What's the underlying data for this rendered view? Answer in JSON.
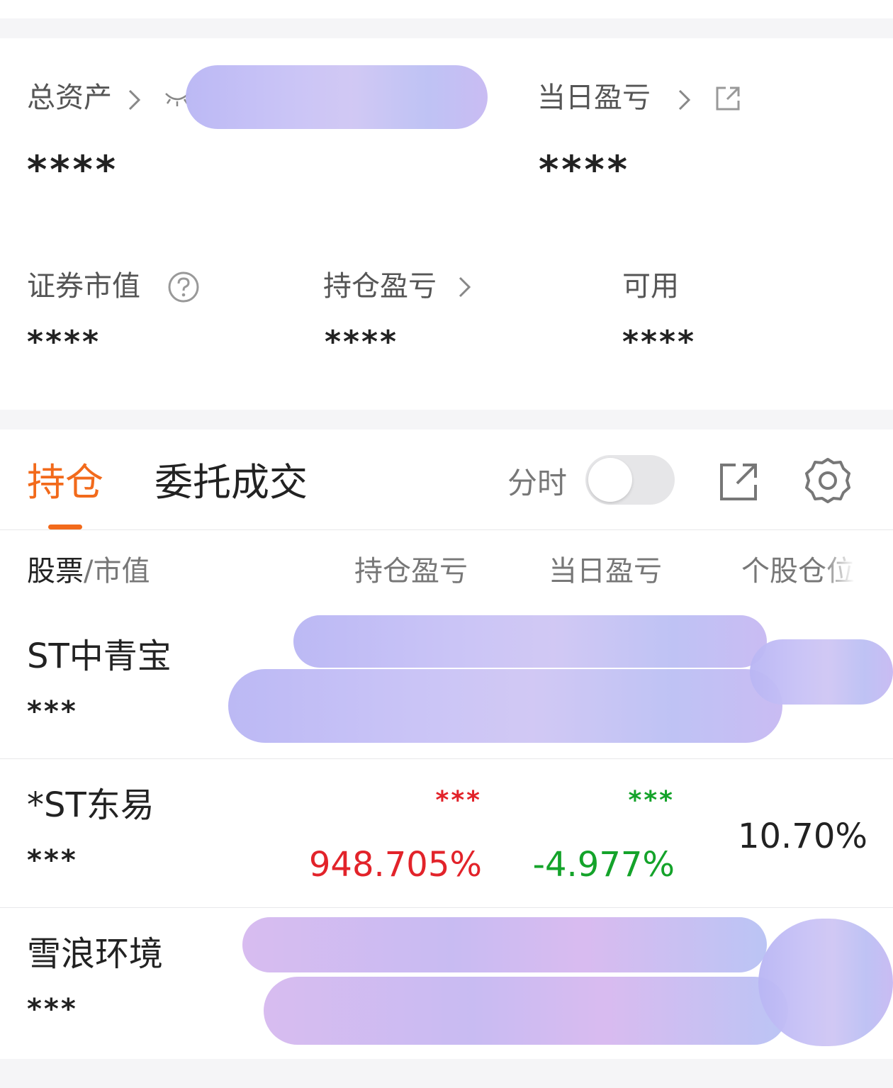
{
  "summary": {
    "total_assets_label": "总资产",
    "total_assets_value": "****",
    "daily_pnl_label": "当日盈亏",
    "daily_pnl_value": "****",
    "market_value_label": "证券市值",
    "market_value_value": "****",
    "position_pnl_label": "持仓盈亏",
    "position_pnl_value": "****",
    "available_label": "可用",
    "available_value": "****"
  },
  "tabs": {
    "positions": "持仓",
    "orders": "委托成交",
    "fenshi_label": "分时",
    "fenshi_enabled": false
  },
  "table": {
    "headers": {
      "stock_main": "股票",
      "stock_sep": "/",
      "stock_sub": "市值",
      "position_pnl": "持仓盈亏",
      "daily_pnl": "当日盈亏",
      "weight": "个股仓位"
    },
    "rows": [
      {
        "name": "ST中青宝",
        "market_value": "***"
      },
      {
        "name": "*ST东易",
        "market_value": "***",
        "position_pnl_amount": "***",
        "position_pnl_pct": "948.705%",
        "daily_pnl_amount": "***",
        "daily_pnl_pct": "-4.977%",
        "weight": "10.70%"
      },
      {
        "name": "雪浪环境",
        "market_value": "***"
      }
    ]
  },
  "colors": {
    "accent": "#f26a1b",
    "gain": "#e2232a",
    "loss": "#14a32a"
  },
  "icons": [
    "chevron-right-icon",
    "eye-closed-icon",
    "external-link-icon",
    "help-circle-icon",
    "share-icon",
    "gear-icon"
  ]
}
